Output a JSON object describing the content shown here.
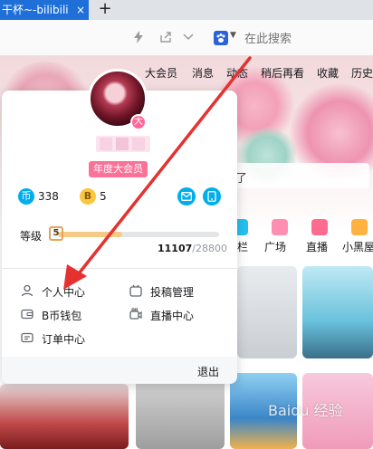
{
  "browser": {
    "tab_title": "干杯~-bilibili",
    "tab_close": "×",
    "new_tab": "+"
  },
  "toolbar": {
    "search_placeholder": "在此搜索"
  },
  "site_nav": {
    "items": [
      "大会员",
      "消息",
      "动态",
      "稍后再看",
      "收藏",
      "历史"
    ]
  },
  "background": {
    "search_char": "了",
    "categories": [
      "栏",
      "广场",
      "直播",
      "小黑屋"
    ]
  },
  "user_popup": {
    "avatar_badge": "大",
    "vip_label": "年度大会员",
    "coin_icon": "币",
    "coins": "338",
    "bcoin_icon": "B",
    "bcoins": "5",
    "level_label": "等级",
    "level_value": "5",
    "level_progress": 0.397,
    "exp_current": "11107",
    "exp_max": "/28800",
    "menu": [
      {
        "label": "个人中心",
        "icon": "user-icon"
      },
      {
        "label": "投稿管理",
        "icon": "upload-manage-icon"
      },
      {
        "label": "B币钱包",
        "icon": "wallet-icon"
      },
      {
        "label": "直播中心",
        "icon": "live-icon"
      },
      {
        "label": "订单中心",
        "icon": "order-icon"
      }
    ],
    "logout": "退出"
  },
  "colors": {
    "vip_pink": "#fb7299",
    "brand_blue": "#00aeec",
    "level_fill": "#f6c985",
    "arrow_red": "#e5312f",
    "tab_blue": "#1f6fd9"
  },
  "watermark": "Baidu 经验"
}
